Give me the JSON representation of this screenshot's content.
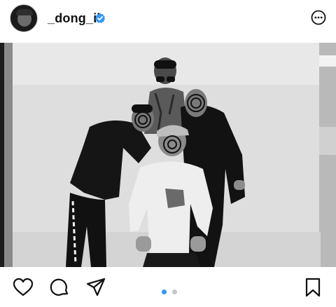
{
  "post": {
    "username": "_dong_ii",
    "verified": true,
    "photo_description_icon": "photo",
    "carousel": {
      "count": 2,
      "active_index": 0
    }
  },
  "icons": {
    "avatar": "avatar",
    "verified": "verified-badge-icon",
    "more": "more-options-icon",
    "like": "heart-icon",
    "comment": "comment-icon",
    "share": "send-icon",
    "save": "bookmark-icon"
  },
  "colors": {
    "verified": "#3797f0",
    "dot_active": "#3797f0",
    "dot_inactive": "#c7c7c7",
    "icon": "#111111"
  }
}
